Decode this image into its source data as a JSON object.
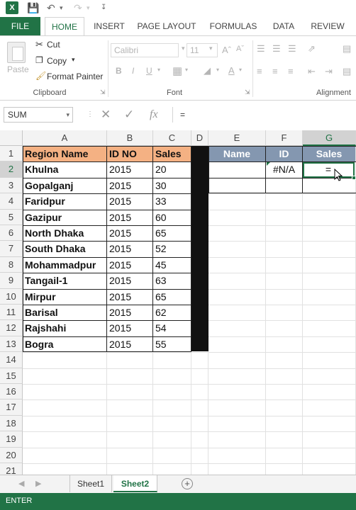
{
  "app": {
    "logo": "X"
  },
  "qat": {
    "icons": [
      "save-icon",
      "undo-icon",
      "redo-icon"
    ]
  },
  "tabs": {
    "file": "FILE",
    "items": [
      "HOME",
      "INSERT",
      "PAGE LAYOUT",
      "FORMULAS",
      "DATA",
      "REVIEW"
    ],
    "active": "HOME"
  },
  "ribbon": {
    "clipboard": {
      "paste": "Paste",
      "cut": "Cut",
      "copy": "Copy",
      "format_painter": "Format Painter",
      "label": "Clipboard"
    },
    "font": {
      "font_name": "Calibri",
      "font_size": "11",
      "bold": "B",
      "italic": "I",
      "underline": "U",
      "label": "Font"
    },
    "alignment": {
      "label": "Alignment"
    }
  },
  "formula_bar": {
    "name_box": "SUM",
    "formula": "=",
    "fx": "fx"
  },
  "sheet": {
    "columns": [
      "A",
      "B",
      "C",
      "D",
      "E",
      "F",
      "G"
    ],
    "rows": [
      "1",
      "2",
      "3",
      "4",
      "5",
      "6",
      "7",
      "8",
      "9",
      "10",
      "11",
      "12",
      "13",
      "14",
      "15",
      "16",
      "17",
      "18",
      "19",
      "20",
      "21"
    ],
    "table1": {
      "headers": [
        "Region Name",
        "ID NO",
        "Sales"
      ],
      "rows": [
        [
          "Khulna",
          "2015",
          "20"
        ],
        [
          "Gopalganj",
          "2015",
          "30"
        ],
        [
          "Faridpur",
          "2015",
          "33"
        ],
        [
          "Gazipur",
          "2015",
          "60"
        ],
        [
          "North Dhaka",
          "2015",
          "65"
        ],
        [
          "South Dhaka",
          "2015",
          "52"
        ],
        [
          "Mohammadpur",
          "2015",
          "45"
        ],
        [
          "Tangail-1",
          "2015",
          "63"
        ],
        [
          "Mirpur",
          "2015",
          "65"
        ],
        [
          "Barisal",
          "2015",
          "62"
        ],
        [
          "Rajshahi",
          "2015",
          "54"
        ],
        [
          "Bogra",
          "2015",
          "55"
        ]
      ]
    },
    "table2": {
      "headers": [
        "Name",
        "ID",
        "Sales"
      ],
      "f2": "#N/A",
      "g2": "="
    },
    "active_cell": "G2",
    "colors": {
      "orange_header": "#f4b183",
      "blue_header": "#8497b0",
      "accent": "#217346"
    }
  },
  "sheet_tabs": {
    "items": [
      "Sheet1",
      "Sheet2"
    ],
    "active": "Sheet2",
    "add": "+"
  },
  "status": {
    "mode": "ENTER"
  }
}
